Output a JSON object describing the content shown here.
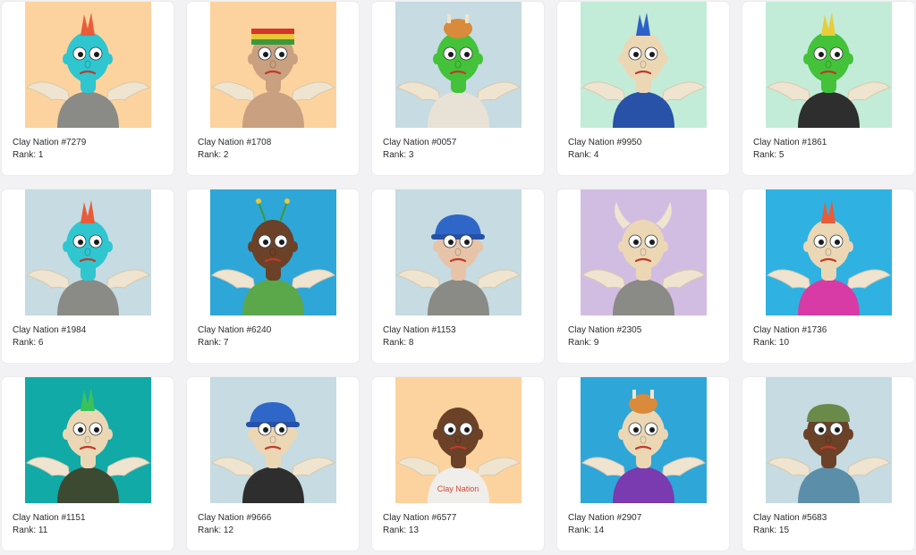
{
  "collection": "Clay Nation",
  "items": [
    {
      "name": "Clay Nation #7279",
      "rank": "Rank: 1",
      "bg": "#fcd39e",
      "skin": "#2fc6cf",
      "mohawk": "#e85c3a",
      "shirt": "#8a8a86",
      "hat": "",
      "text_on_shirt": ""
    },
    {
      "name": "Clay Nation #1708",
      "rank": "Rank: 2",
      "bg": "#fcd39e",
      "skin": "#c9a080",
      "mohawk": "",
      "shirt": "#c9a080",
      "hat": "rasta",
      "text_on_shirt": ""
    },
    {
      "name": "Clay Nation #0057",
      "rank": "Rank: 3",
      "bg": "#c6dbe2",
      "skin": "#43c23a",
      "mohawk": "",
      "shirt": "#e8e2d6",
      "hat": "chicken",
      "text_on_shirt": ""
    },
    {
      "name": "Clay Nation #9950",
      "rank": "Rank: 4",
      "bg": "#c2ecd8",
      "skin": "#ecd7b5",
      "mohawk": "#2d61c8",
      "shirt": "#2852a8",
      "hat": "",
      "text_on_shirt": ""
    },
    {
      "name": "Clay Nation #1861",
      "rank": "Rank: 5",
      "bg": "#c2ecd8",
      "skin": "#43c23a",
      "mohawk": "#e8cc3c",
      "shirt": "#2e2e2e",
      "hat": "",
      "text_on_shirt": ""
    },
    {
      "name": "Clay Nation #1984",
      "rank": "Rank: 6",
      "bg": "#c6dbe2",
      "skin": "#2fc6cf",
      "mohawk": "#e85c3a",
      "shirt": "#8a8a86",
      "hat": "",
      "text_on_shirt": ""
    },
    {
      "name": "Clay Nation #6240",
      "rank": "Rank: 7",
      "bg": "#2fa6d8",
      "skin": "#6b4128",
      "mohawk": "",
      "shirt": "#5aa84a",
      "hat": "antenna",
      "text_on_shirt": ""
    },
    {
      "name": "Clay Nation #1153",
      "rank": "Rank: 8",
      "bg": "#c6dbe2",
      "skin": "#e7c4a8",
      "mohawk": "",
      "shirt": "#8a8a86",
      "hat": "cap",
      "text_on_shirt": ""
    },
    {
      "name": "Clay Nation #2305",
      "rank": "Rank: 9",
      "bg": "#d2bde2",
      "skin": "#ecd7b5",
      "mohawk": "",
      "shirt": "#8a8a86",
      "hat": "horns",
      "text_on_shirt": ""
    },
    {
      "name": "Clay Nation #1736",
      "rank": "Rank: 10",
      "bg": "#2fb2e2",
      "skin": "#ecd7b5",
      "mohawk": "#e85c3a",
      "shirt": "#d83aa6",
      "hat": "",
      "text_on_shirt": ""
    },
    {
      "name": "Clay Nation #1151",
      "rank": "Rank: 11",
      "bg": "#12aaa6",
      "skin": "#ecd7b5",
      "mohawk": "#3ac25a",
      "shirt": "#3d4a32",
      "hat": "",
      "text_on_shirt": ""
    },
    {
      "name": "Clay Nation #9666",
      "rank": "Rank: 12",
      "bg": "#c6dbe2",
      "skin": "#ecd7b5",
      "mohawk": "",
      "shirt": "#2e2e2e",
      "hat": "cap",
      "text_on_shirt": ""
    },
    {
      "name": "Clay Nation #6577",
      "rank": "Rank: 13",
      "bg": "#fcd39e",
      "skin": "#6b4128",
      "mohawk": "",
      "shirt": "#f0eeea",
      "hat": "",
      "text_on_shirt": "Clay Nation"
    },
    {
      "name": "Clay Nation #2907",
      "rank": "Rank: 14",
      "bg": "#2fa6d8",
      "skin": "#ecd7b5",
      "mohawk": "",
      "shirt": "#7a3ab0",
      "hat": "chicken",
      "text_on_shirt": ""
    },
    {
      "name": "Clay Nation #5683",
      "rank": "Rank: 15",
      "bg": "#c6dbe2",
      "skin": "#6b4128",
      "mohawk": "",
      "shirt": "#5b8ea8",
      "hat": "beanie",
      "text_on_shirt": ""
    }
  ]
}
